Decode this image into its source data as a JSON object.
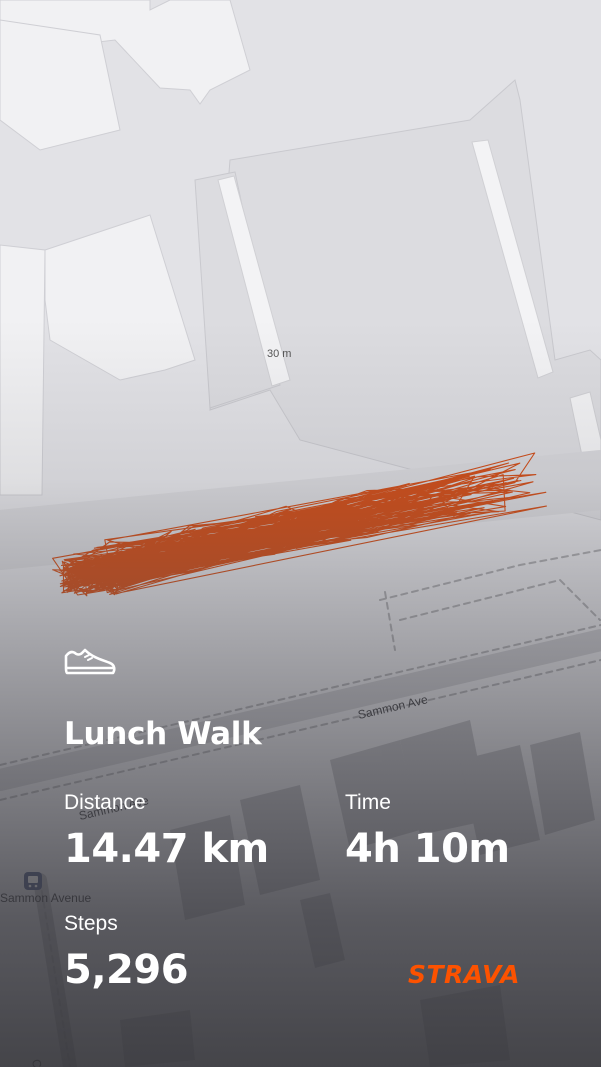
{
  "map": {
    "scale_label": "30 m",
    "street_labels": [
      "Sammon Ave",
      "Sammon Ave",
      "Sammon Avenue",
      "Ccy"
    ],
    "bus_stop_icon": "bus-stop-icon",
    "route_color": "#cf4a14"
  },
  "activity": {
    "type_icon": "shoe-icon",
    "title": "Lunch Walk",
    "stats": [
      {
        "label": "Distance",
        "value": "14.47 km"
      },
      {
        "label": "Time",
        "value": "4h 10m"
      },
      {
        "label": "Steps",
        "value": "5,296"
      }
    ]
  },
  "brand": {
    "name": "STRAVA",
    "color": "#fc5200"
  }
}
